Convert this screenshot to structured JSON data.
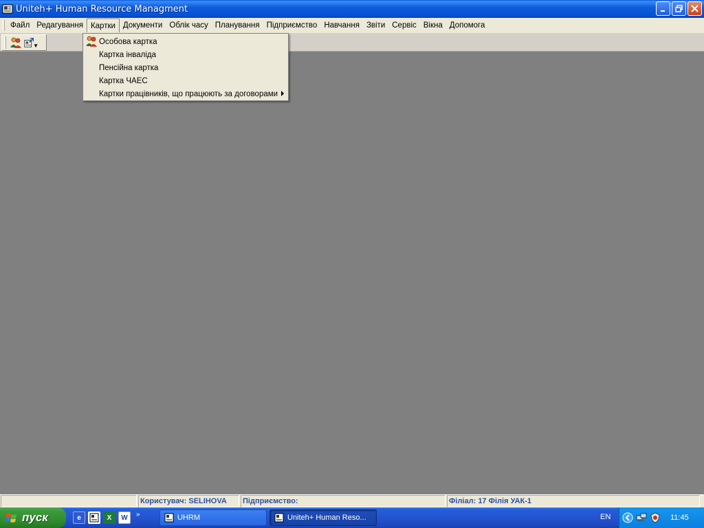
{
  "window": {
    "title": "Uniteh+ Human Resource Managment"
  },
  "menu": {
    "items": [
      "Файл",
      "Редагування",
      "Картки",
      "Документи",
      "Облік часу",
      "Планування",
      "Підприємство",
      "Навчання",
      "Звіти",
      "Сервіс",
      "Вікна",
      "Допомога"
    ],
    "active_index": 2
  },
  "dropdown": {
    "items": [
      {
        "label": "Особова картка",
        "icon": "people-icon",
        "submenu": false
      },
      {
        "label": "Картка інваліда",
        "icon": "",
        "submenu": false
      },
      {
        "label": "Пенсійна картка",
        "icon": "",
        "submenu": false
      },
      {
        "label": "Картка ЧАЕС",
        "icon": "",
        "submenu": false
      },
      {
        "label": "Картки працівників, що працюють за договорами",
        "icon": "",
        "submenu": true
      }
    ]
  },
  "statusbar": {
    "user": "Користувач: SELIHOVA",
    "enterprise": "Підприємство:",
    "branch": "Філіал: 17 Філія УАК-1"
  },
  "taskbar": {
    "start_label": "пуск",
    "tasks": [
      {
        "label": "UHRM",
        "active": false
      },
      {
        "label": "Uniteh+ Human Reso...",
        "active": true
      }
    ],
    "language": "EN",
    "clock": "11:45"
  },
  "colors": {
    "desktop": "#808080",
    "statusbar_text": "#2f4f9f"
  }
}
